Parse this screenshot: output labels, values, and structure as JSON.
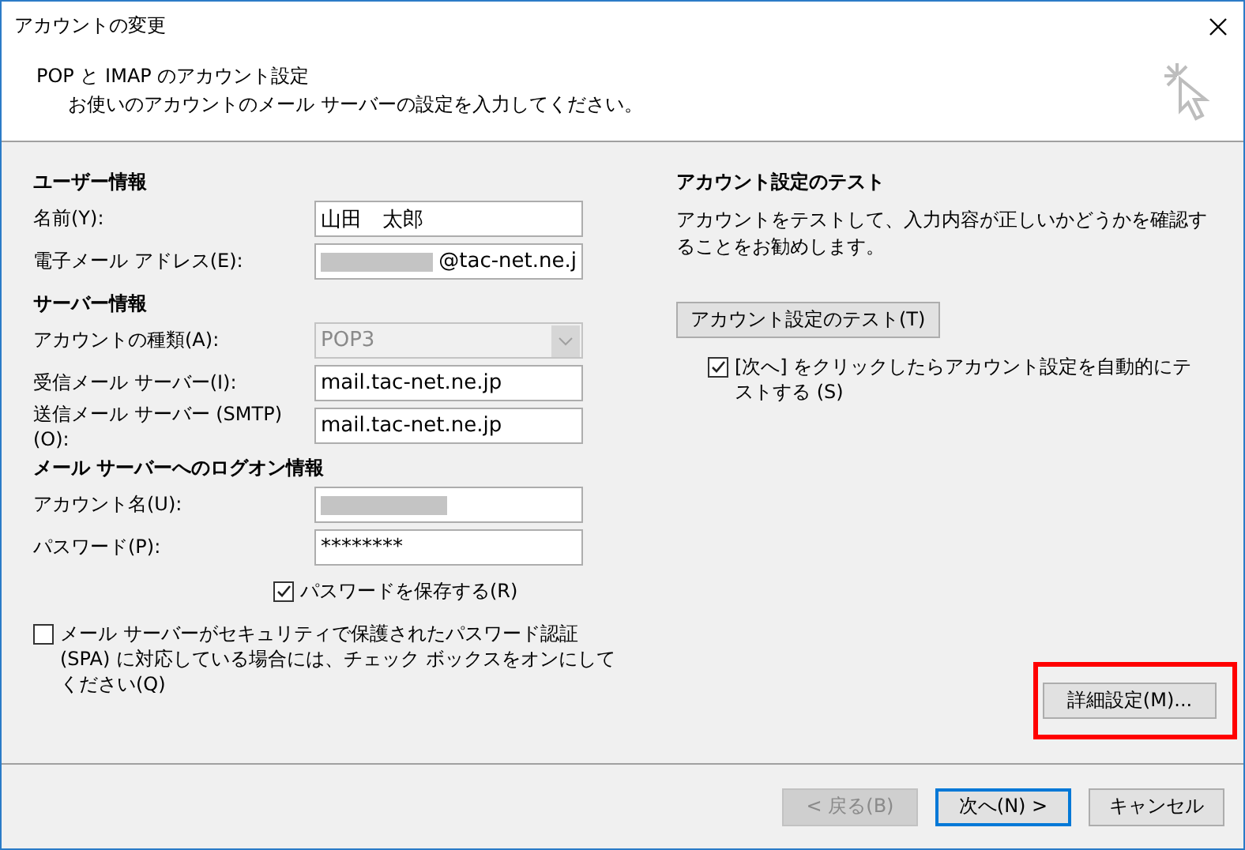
{
  "window": {
    "title": "アカウントの変更"
  },
  "header": {
    "title": "POP と IMAP のアカウント設定",
    "subtitle": "お使いのアカウントのメール サーバーの設定を入力してください。"
  },
  "sections": [
    {
      "heading": "ユーザー情報",
      "fields": [
        {
          "kind": "text",
          "label": "名前(Y):",
          "value": "山田　太郎"
        },
        {
          "kind": "redacted_prefix",
          "label": "電子メール アドレス(E):",
          "value": "@tac-net.ne.j"
        }
      ]
    },
    {
      "heading": "サーバー情報",
      "fields": [
        {
          "kind": "select",
          "label": "アカウントの種類(A):",
          "value": "POP3",
          "disabled": true
        },
        {
          "kind": "text",
          "label": "受信メール サーバー(I):",
          "value": "mail.tac-net.ne.jp"
        },
        {
          "kind": "text",
          "label": "送信メール サーバー (SMTP)(O):",
          "value": "mail.tac-net.ne.jp"
        }
      ]
    },
    {
      "heading": "メール サーバーへのログオン情報",
      "fields": [
        {
          "kind": "redacted",
          "label": "アカウント名(U):"
        },
        {
          "kind": "password",
          "label": "パスワード(P):",
          "value": "********"
        }
      ]
    }
  ],
  "save_password": {
    "label": "パスワードを保存する(R)",
    "checked": true
  },
  "spa": {
    "label": "メール サーバーがセキュリティで保護されたパスワード認証 (SPA) に対応している場合には、チェック ボックスをオンにしてください(Q)",
    "checked": false
  },
  "test": {
    "heading": "アカウント設定のテスト",
    "description": "アカウントをテストして、入力内容が正しいかどうかを確認することをお勧めします。",
    "button": "アカウント設定のテスト(T)",
    "auto_test": {
      "label": "[次へ] をクリックしたらアカウント設定を自動的にテストする (S)",
      "checked": true
    }
  },
  "more_settings": {
    "label": "詳細設定(M)...",
    "highlighted": true
  },
  "buttons": [
    {
      "label": "< 戻る(B)",
      "disabled": true,
      "default": false
    },
    {
      "label": "次へ(N) >",
      "disabled": false,
      "default": true
    },
    {
      "label": "キャンセル",
      "disabled": false,
      "default": false
    }
  ]
}
